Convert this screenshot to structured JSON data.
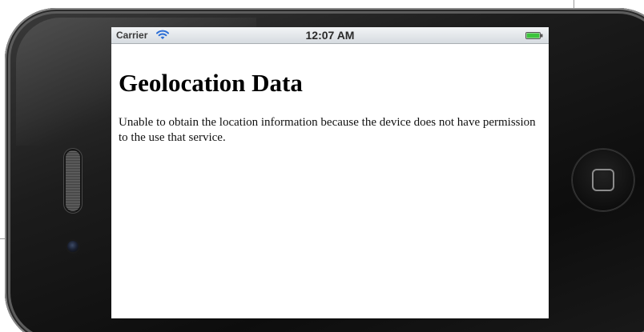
{
  "status_bar": {
    "carrier": "Carrier",
    "time": "12:07 AM",
    "wifi_icon": "wifi-icon",
    "battery_icon": "battery-icon",
    "battery_level": 1.0,
    "battery_color": "#3cc43c"
  },
  "page": {
    "title": "Geolocation Data",
    "message": "Unable to obtain the location information because the device does not have permission to the use that service."
  },
  "device": {
    "home_button_icon": "home-button-icon",
    "speaker_icon": "speaker-icon",
    "camera_icon": "camera-icon"
  }
}
